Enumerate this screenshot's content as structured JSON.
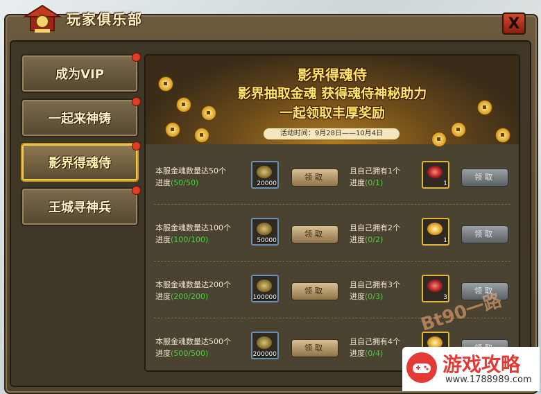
{
  "window": {
    "title": "玩家俱乐部",
    "close_label": "X"
  },
  "tabs": [
    {
      "label": "成为VIP"
    },
    {
      "label": "一起来神铸"
    },
    {
      "label": "影界得魂侍",
      "active": true
    },
    {
      "label": "王城寻神兵"
    }
  ],
  "banner": {
    "title": "影界得魂侍",
    "line1": "影界抽取金魂 获得魂侍神秘助力",
    "line2": "一起领取丰厚奖励",
    "time": "活动时间：9月28日——10月4日"
  },
  "rows": [
    {
      "req": "本服金魂数量达50个",
      "progress_label": "进度",
      "progress": "(50/50)",
      "reward_count": "20000",
      "button": "领取",
      "req2": "且自己拥有1个",
      "progress2": "(0/1)",
      "reward2_count": "1",
      "button2": "领取"
    },
    {
      "req": "本服金魂数量达100个",
      "progress_label": "进度",
      "progress": "(100/100)",
      "reward_count": "50000",
      "button": "领取",
      "req2": "且自己拥有2个",
      "progress2": "(0/2)",
      "reward2_count": "1",
      "button2": "领取"
    },
    {
      "req": "本服金魂数量达200个",
      "progress_label": "进度",
      "progress": "(200/200)",
      "reward_count": "100000",
      "button": "领取",
      "req2": "且自己拥有3个",
      "progress2": "(0/3)",
      "reward2_count": "3",
      "button2": "领取"
    },
    {
      "req": "本服金魂数量达500个",
      "progress_label": "进度",
      "progress": "(500/500)",
      "reward_count": "200000",
      "button": "领取",
      "req2": "且自己拥有4个",
      "progress2": "(0/4)",
      "reward2_count": "",
      "button2": "领取"
    }
  ],
  "watermark": {
    "site_name": "游戏攻略",
    "site_url": "www.1788989.com",
    "corner_mark": "Bt90一路"
  },
  "colors": {
    "progress_green": "#48d43c",
    "title_gold": "#ffe36a",
    "notify_red": "#e33a24"
  }
}
